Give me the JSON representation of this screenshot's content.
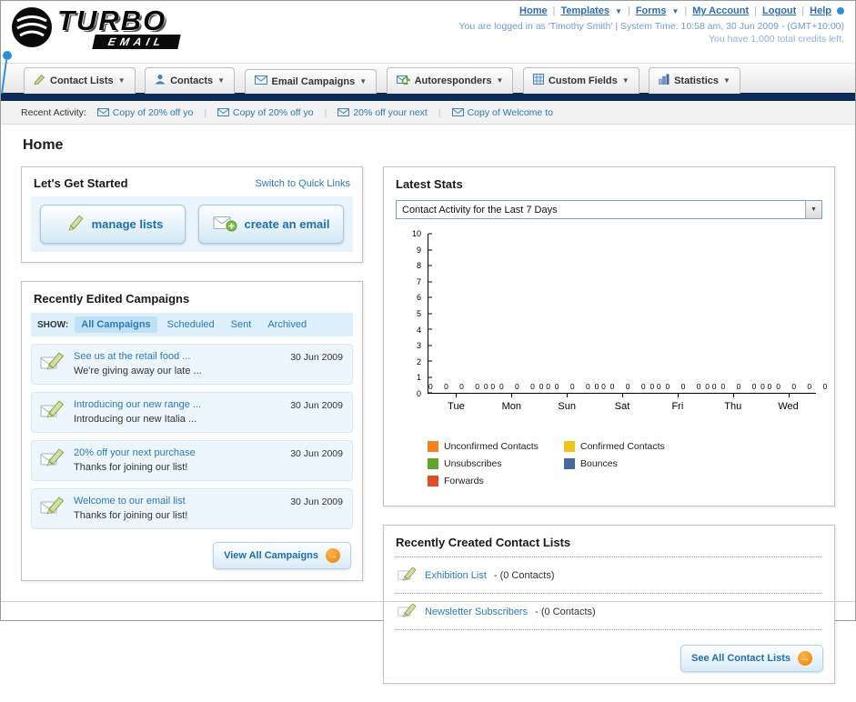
{
  "theme": {
    "navbar_dark": "#0d2b57",
    "link_blue": "#2a7ab8",
    "accent_orange": "#f07f00",
    "panel_light_blue": "#edf6fd"
  },
  "header": {
    "nav_links": [
      "Home",
      "Templates",
      "Forms",
      "My Account",
      "Logout",
      "Help"
    ],
    "login_info": "You are logged in as 'Timothy Smith' | System Time: 10:58 am, 30 Jun 2009 - (GMT+10:00)",
    "credits": "You have 1,000 total credits left."
  },
  "logo": {
    "line1": "TURBO",
    "line2": "EMAIL"
  },
  "tabs": [
    "Contact Lists",
    "Contacts",
    "Email Campaigns",
    "Autoresponders",
    "Custom Fields",
    "Statistics"
  ],
  "activity": {
    "label": "Recent Activity:",
    "items": [
      "Copy of 20% off yo",
      "Copy of 20% off yo",
      "20% off your next",
      "Copy of Welcome to"
    ]
  },
  "page_title": "Home",
  "get_started": {
    "title": "Let's Get Started",
    "switch_link": "Switch to Quick Links",
    "manage_lists": "manage lists",
    "create_email": "create an email"
  },
  "campaigns": {
    "title": "Recently Edited Campaigns",
    "show_label": "SHOW:",
    "filters": [
      "All Campaigns",
      "Scheduled",
      "Sent",
      "Archived"
    ],
    "items": [
      {
        "title": "See us at the retail food ...",
        "subtitle": "We're giving away our late ...",
        "date": "30 Jun 2009"
      },
      {
        "title": "Introducing our new range ...",
        "subtitle": "Introducing our new Italia ...",
        "date": "30 Jun 2009"
      },
      {
        "title": "20% off your next purchase",
        "subtitle": "Thanks for joining our list!",
        "date": "30 Jun 2009"
      },
      {
        "title": "Welcome to our email list",
        "subtitle": "Thanks for joining our list!",
        "date": "30 Jun 2009"
      }
    ],
    "view_all": "View All Campaigns"
  },
  "stats": {
    "title": "Latest Stats",
    "dropdown_value": "Contact Activity for the Last 7 Days"
  },
  "chart_data": {
    "type": "bar",
    "title": "Contact Activity for the Last 7 Days",
    "categories": [
      "Tue",
      "Mon",
      "Sun",
      "Sat",
      "Fri",
      "Thu",
      "Wed"
    ],
    "series": [
      {
        "name": "Unconfirmed Contacts",
        "color": "#f5821f",
        "values": [
          0,
          0,
          0,
          0,
          0,
          0,
          0
        ]
      },
      {
        "name": "Confirmed Contacts",
        "color": "#f0c420",
        "values": [
          0,
          0,
          0,
          0,
          0,
          0,
          0
        ]
      },
      {
        "name": "Unsubscribes",
        "color": "#62a630",
        "values": [
          0,
          0,
          0,
          0,
          0,
          0,
          0
        ]
      },
      {
        "name": "Bounces",
        "color": "#4a68a0",
        "values": [
          0,
          0,
          0,
          0,
          0,
          0,
          0
        ]
      },
      {
        "name": "Forwards",
        "color": "#e44c22",
        "values": [
          0,
          0,
          0,
          0,
          0,
          0,
          0
        ]
      }
    ],
    "ylim": [
      0,
      10
    ],
    "yticks": [
      10,
      9,
      8,
      7,
      6,
      5,
      4,
      3,
      2,
      1,
      0
    ],
    "grid": false,
    "legend_position": "bottom"
  },
  "contact_lists": {
    "title": "Recently Created Contact Lists",
    "items": [
      {
        "name": "Exhibition List",
        "suffix": "- (0 Contacts)"
      },
      {
        "name": "Newsletter Subscribers",
        "suffix": "- (0 Contacts)"
      }
    ],
    "see_all": "See All Contact Lists"
  }
}
